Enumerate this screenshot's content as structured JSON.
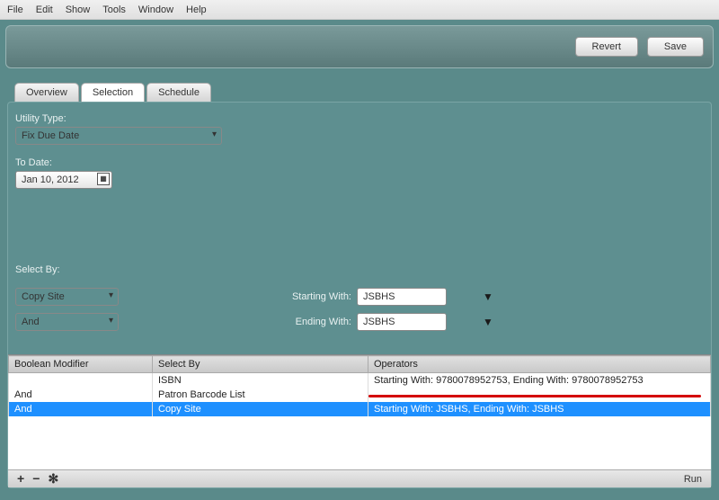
{
  "menu": {
    "file": "File",
    "edit": "Edit",
    "show": "Show",
    "tools": "Tools",
    "window": "Window",
    "help": "Help"
  },
  "toolbar": {
    "revert": "Revert",
    "save": "Save"
  },
  "tabs": {
    "overview": "Overview",
    "selection": "Selection",
    "schedule": "Schedule"
  },
  "form": {
    "utility_type_label": "Utility Type:",
    "utility_type_value": "Fix Due Date",
    "to_date_label": "To Date:",
    "to_date_value": "Jan 10, 2012",
    "select_by_label": "Select By:",
    "select_by_value": "Copy Site",
    "bool_value": "And",
    "starting_with_label": "Starting With:",
    "starting_with_value": "JSBHS",
    "ending_with_label": "Ending With:",
    "ending_with_value": "JSBHS"
  },
  "table": {
    "headers": {
      "bool": "Boolean Modifier",
      "selectby": "Select By",
      "operators": "Operators"
    },
    "rows": [
      {
        "bool": "",
        "selectby": "ISBN",
        "operators": "Starting With: 9780078952753, Ending With: 9780078952753"
      },
      {
        "bool": "And",
        "selectby": "Patron Barcode List",
        "operators": ""
      },
      {
        "bool": "And",
        "selectby": "Copy Site",
        "operators": "Starting With: JSBHS, Ending With: JSBHS"
      }
    ]
  },
  "footer": {
    "run": "Run"
  },
  "icons": {
    "plus": "+",
    "minus": "−",
    "gear": "✻",
    "dropdown": "▼",
    "calendar": "▦"
  }
}
